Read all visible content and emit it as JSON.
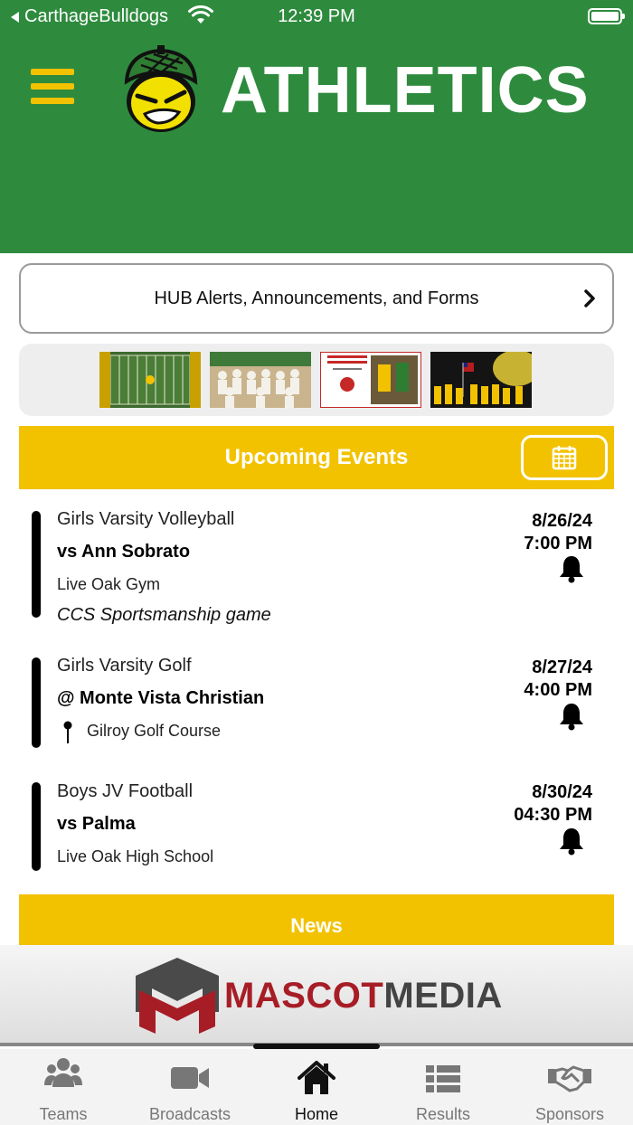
{
  "status_bar": {
    "back_label": "CarthageBulldogs",
    "time": "12:39 PM"
  },
  "header": {
    "title": "ATHLETICS"
  },
  "hub": {
    "label": "HUB Alerts, Announcements, and Forms"
  },
  "events_section": {
    "title": "Upcoming Events",
    "events": [
      {
        "sport": "Girls Varsity Volleyball",
        "opponent": "vs Ann Sobrato",
        "venue": "Live Oak Gym",
        "note": "CCS Sportsmanship game",
        "date": "8/26/24",
        "time": "7:00 PM",
        "venue_icon": ""
      },
      {
        "sport": "Girls Varsity Golf",
        "opponent": "@ Monte Vista Christian",
        "venue": "Gilroy Golf Course",
        "note": "",
        "date": "8/27/24",
        "time": "4:00 PM",
        "venue_icon": "map-pin-icon"
      },
      {
        "sport": "Boys JV Football",
        "opponent": "vs Palma",
        "venue": "Live Oak High School",
        "note": "",
        "date": "8/30/24",
        "time": "04:30 PM",
        "venue_icon": ""
      }
    ]
  },
  "news_section": {
    "title": "News"
  },
  "sponsor": {
    "brand_part1": "MASCOT",
    "brand_part2": "MEDIA"
  },
  "tabs": [
    {
      "label": "Teams",
      "icon": "users-icon",
      "active": false
    },
    {
      "label": "Broadcasts",
      "icon": "video-camera-icon",
      "active": false
    },
    {
      "label": "Home",
      "icon": "home-icon",
      "active": true
    },
    {
      "label": "Results",
      "icon": "list-icon",
      "active": false
    },
    {
      "label": "Sponsors",
      "icon": "handshake-icon",
      "active": false
    }
  ],
  "colors": {
    "header_green": "#2e8b3e",
    "accent_yellow": "#f2c200",
    "sponsor_red": "#a71d26"
  }
}
